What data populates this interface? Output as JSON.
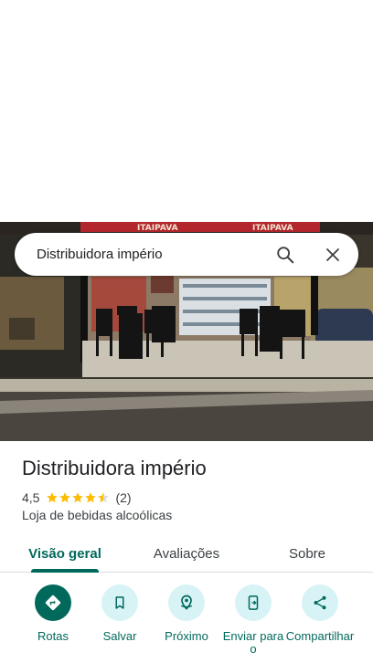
{
  "search": {
    "query": "Distribuidora império"
  },
  "place": {
    "name": "Distribuidora império",
    "rating": "4,5",
    "stars": 4.5,
    "review_count": "(2)",
    "category": "Loja de bebidas alcoólicas"
  },
  "photo": {
    "banner_text_1": "ITAIPAVA",
    "banner_text_2": "ITAIPAVA"
  },
  "tabs": [
    {
      "label": "Visão geral",
      "active": true
    },
    {
      "label": "Avaliações",
      "active": false
    },
    {
      "label": "Sobre",
      "active": false
    }
  ],
  "actions": [
    {
      "label": "Rotas",
      "icon": "directions-icon"
    },
    {
      "label": "Salvar",
      "icon": "bookmark-icon"
    },
    {
      "label": "Próximo",
      "icon": "nearby-icon"
    },
    {
      "label": "Enviar para o",
      "icon": "send-to-phone-icon"
    },
    {
      "label": "Compartilhar",
      "icon": "share-icon"
    }
  ],
  "colors": {
    "accent": "#00695c",
    "action_bg": "#d7f3f6",
    "star": "#fbbc04",
    "banner": "#b3262d"
  }
}
